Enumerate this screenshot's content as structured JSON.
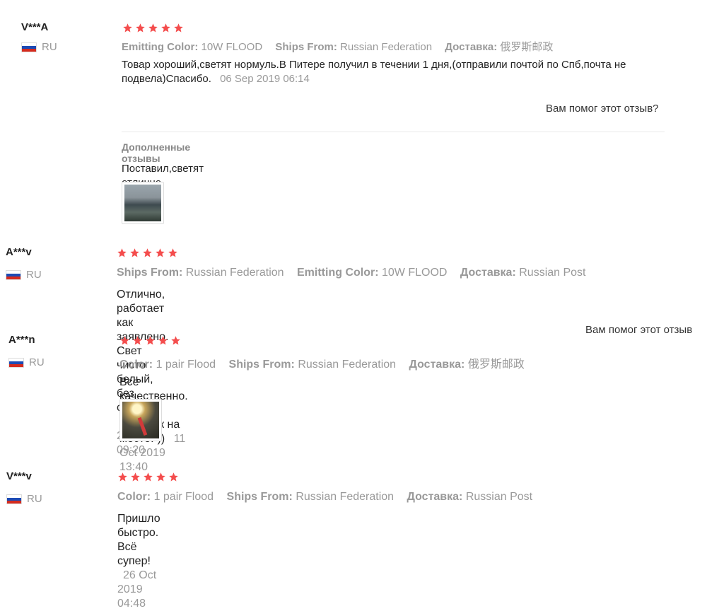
{
  "labels": {
    "emitting_color": "Emitting Color:",
    "ships_from": "Ships From:",
    "delivery": "Доставка:",
    "color": "Color:",
    "helpful": "Вам помог этот отзыв?",
    "helpful_cut": "Вам помог этот отзыв",
    "additional": "Дополненные отзывы"
  },
  "star_color": "#f44d4d",
  "reviews": [
    {
      "user": "V***A",
      "country": "RU",
      "rating": 5,
      "meta": [
        {
          "k": "Emitting Color:",
          "v": "10W FLOOD"
        },
        {
          "k": "Ships From:",
          "v": "Russian Federation"
        },
        {
          "k": "Доставка:",
          "v": "俄罗斯邮政"
        }
      ],
      "text": "Товар хороший,светят нормуль.В Питере получил в течении 1 дня,(отправили почтой по Спб,почта не подвела)Спасибо.",
      "date": "06 Sep 2019 06:14",
      "additional_text": "Поставил,светят отлично."
    },
    {
      "user": "A***v",
      "country": "RU",
      "rating": 5,
      "meta": [
        {
          "k": "Ships From:",
          "v": "Russian Federation"
        },
        {
          "k": "Emitting Color:",
          "v": "10W FLOOD"
        },
        {
          "k": "Доставка:",
          "v": "Russian Post"
        }
      ],
      "text": "Отлично, работает как заявлено. Свет чисто белый, без синевы.",
      "date": "11 Jan 2020 09:20"
    },
    {
      "user": "A***n",
      "country": "RU",
      "rating": 5,
      "meta": [
        {
          "k": "Color:",
          "v": "1 pair Flood"
        },
        {
          "k": "Ships From:",
          "v": "Russian Federation"
        },
        {
          "k": "Доставка:",
          "v": "俄罗斯邮政"
        }
      ],
      "text": "Все качественно. Быстро. Подарок на местеꝐ))",
      "date": "11 Oct 2019 13:40"
    },
    {
      "user": "V***v",
      "country": "RU",
      "rating": 5,
      "meta": [
        {
          "k": "Color:",
          "v": "1 pair Flood"
        },
        {
          "k": "Ships From:",
          "v": "Russian Federation"
        },
        {
          "k": "Доставка:",
          "v": "Russian Post"
        }
      ],
      "text": "Пришло быстро. Всё супер!",
      "date": "26 Oct 2019 04:48"
    }
  ]
}
